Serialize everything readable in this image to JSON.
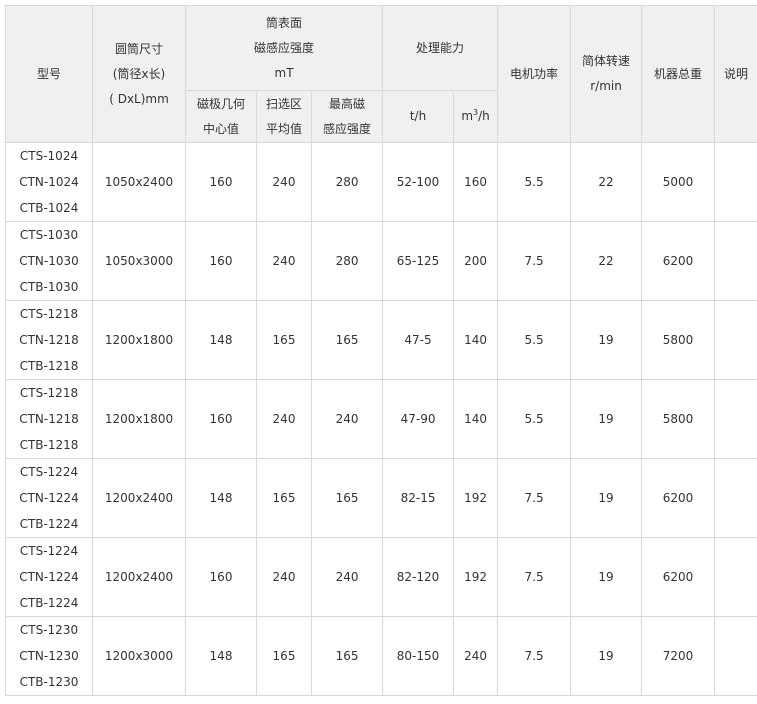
{
  "headers": {
    "model": "型号",
    "drum_size": [
      "圆筒尺寸",
      "(筒径x长)",
      "( DxL)mm"
    ],
    "surface_field": [
      "筒表面",
      "磁感应强度",
      "mT"
    ],
    "pole_center": [
      "磁极几何",
      "中心值"
    ],
    "sweep_avg": [
      "扫选区",
      "平均值"
    ],
    "max_field": [
      "最高磁",
      "感应强度"
    ],
    "capacity": "处理能力",
    "cap_th": "t/h",
    "cap_m3h_base": "m",
    "cap_m3h_sup": "3",
    "cap_m3h_tail": "/h",
    "motor_power": "电机功率",
    "drum_speed": [
      "简体转速",
      "r/min"
    ],
    "weight": "机器总重",
    "note": "说明"
  },
  "rows": [
    {
      "models": [
        "CTS-1024",
        "CTN-1024",
        "CTB-1024"
      ],
      "size": "1050x2400",
      "pole": "160",
      "sweep": "240",
      "max": "280",
      "th": "52-100",
      "m3h": "160",
      "power": "5.5",
      "speed": "22",
      "weight": "5000",
      "note": ""
    },
    {
      "models": [
        "CTS-1030",
        "CTN-1030",
        "CTB-1030"
      ],
      "size": "1050x3000",
      "pole": "160",
      "sweep": "240",
      "max": "280",
      "th": "65-125",
      "m3h": "200",
      "power": "7.5",
      "speed": "22",
      "weight": "6200",
      "note": ""
    },
    {
      "models": [
        "CTS-1218",
        "CTN-1218",
        "CTB-1218"
      ],
      "size": "1200x1800",
      "pole": "148",
      "sweep": "165",
      "max": "165",
      "th": "47-5",
      "m3h": "140",
      "power": "5.5",
      "speed": "19",
      "weight": "5800",
      "note": ""
    },
    {
      "models": [
        "CTS-1218",
        "CTN-1218",
        "CTB-1218"
      ],
      "size": "1200x1800",
      "pole": "160",
      "sweep": "240",
      "max": "240",
      "th": "47-90",
      "m3h": "140",
      "power": "5.5",
      "speed": "19",
      "weight": "5800",
      "note": ""
    },
    {
      "models": [
        "CTS-1224",
        "CTN-1224",
        "CTB-1224"
      ],
      "size": "1200x2400",
      "pole": "148",
      "sweep": "165",
      "max": "165",
      "th": "82-15",
      "m3h": "192",
      "power": "7.5",
      "speed": "19",
      "weight": "6200",
      "note": ""
    },
    {
      "models": [
        "CTS-1224",
        "CTN-1224",
        "CTB-1224"
      ],
      "size": "1200x2400",
      "pole": "160",
      "sweep": "240",
      "max": "240",
      "th": "82-120",
      "m3h": "192",
      "power": "7.5",
      "speed": "19",
      "weight": "6200",
      "note": ""
    },
    {
      "models": [
        "CTS-1230",
        "CTN-1230",
        "CTB-1230"
      ],
      "size": "1200x3000",
      "pole": "148",
      "sweep": "165",
      "max": "165",
      "th": "80-150",
      "m3h": "240",
      "power": "7.5",
      "speed": "19",
      "weight": "7200",
      "note": ""
    }
  ]
}
